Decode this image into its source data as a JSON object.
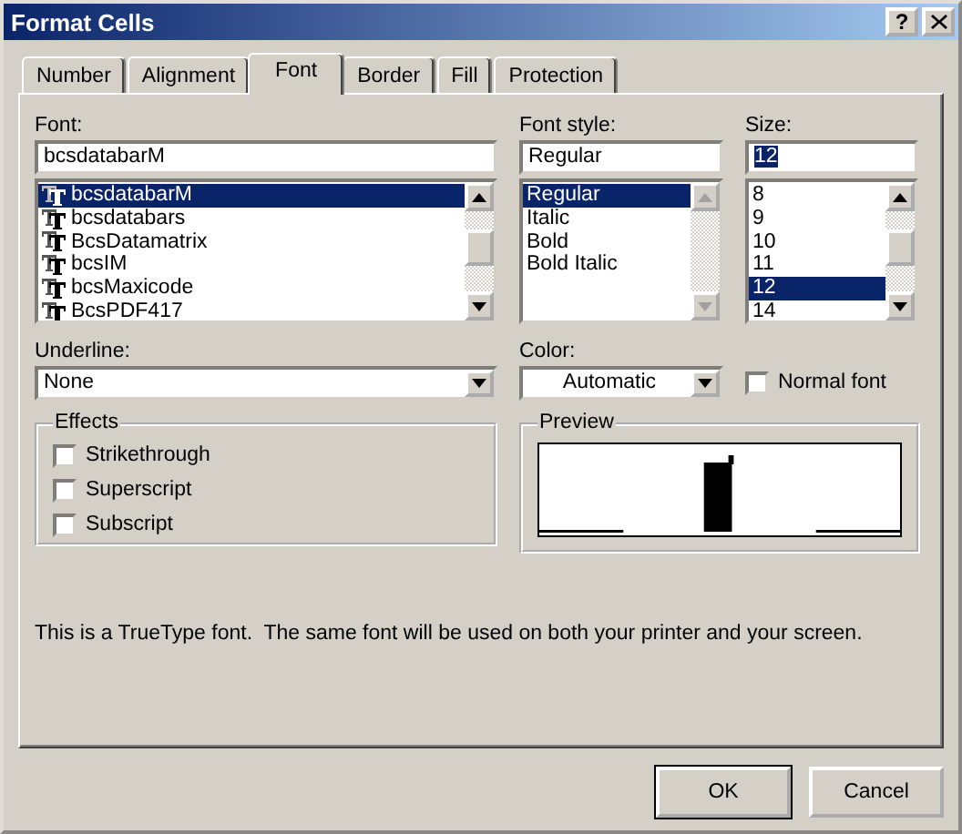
{
  "window": {
    "title": "Format Cells",
    "help": "?"
  },
  "tabs": [
    {
      "label": "Number",
      "selected": false
    },
    {
      "label": "Alignment",
      "selected": false
    },
    {
      "label": "Font",
      "selected": true
    },
    {
      "label": "Border",
      "selected": false
    },
    {
      "label": "Fill",
      "selected": false
    },
    {
      "label": "Protection",
      "selected": false
    }
  ],
  "lists": [
    {
      "label": "Font:",
      "value": "bcsdatabarM",
      "value_highlighted": false,
      "with_icons": true,
      "scroll_enabled": true,
      "items": [
        {
          "label": "bcsdatabarM",
          "selected": true
        },
        {
          "label": "bcsdatabars",
          "selected": false
        },
        {
          "label": "BcsDatamatrix",
          "selected": false
        },
        {
          "label": "bcsIM",
          "selected": false
        },
        {
          "label": "bcsMaxicode",
          "selected": false
        },
        {
          "label": "BcsPDF417",
          "selected": false
        }
      ]
    },
    {
      "label": "Font style:",
      "value": "Regular",
      "value_highlighted": false,
      "with_icons": false,
      "scroll_enabled": false,
      "items": [
        {
          "label": "Regular",
          "selected": true
        },
        {
          "label": "Italic",
          "selected": false
        },
        {
          "label": "Bold",
          "selected": false
        },
        {
          "label": "Bold Italic",
          "selected": false
        }
      ]
    },
    {
      "label": "Size:",
      "value": "12",
      "value_highlighted": true,
      "with_icons": false,
      "scroll_enabled": true,
      "items": [
        {
          "label": "8",
          "selected": false
        },
        {
          "label": "9",
          "selected": false
        },
        {
          "label": "10",
          "selected": false
        },
        {
          "label": "11",
          "selected": false
        },
        {
          "label": "12",
          "selected": true
        },
        {
          "label": "14",
          "selected": false
        }
      ]
    }
  ],
  "underline": {
    "label": "Underline:",
    "value": "None"
  },
  "color": {
    "label": "Color:",
    "value": "Automatic"
  },
  "normal_font": {
    "label": "Normal font",
    "checked": false
  },
  "effects": {
    "title": "Effects",
    "options": [
      {
        "label": "Strikethrough",
        "checked": false
      },
      {
        "label": "Superscript",
        "checked": false
      },
      {
        "label": "Subscript",
        "checked": false
      }
    ]
  },
  "preview": {
    "title": "Preview"
  },
  "note": "This is a TrueType font.  The same font will be used on both your printer and your screen.",
  "buttons": [
    {
      "label": "OK",
      "default": true
    },
    {
      "label": "Cancel",
      "default": false
    }
  ]
}
